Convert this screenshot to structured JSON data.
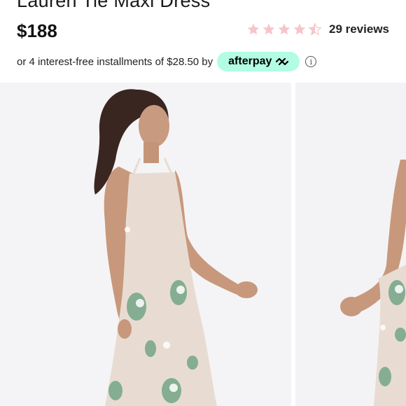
{
  "product": {
    "title": "Lauren Tie Maxi Dress",
    "price": "$188"
  },
  "rating": {
    "stars_value": 4.5,
    "stars_max": 5,
    "star_color": "#f7c5c8",
    "reviews_label": "29 reviews"
  },
  "payment": {
    "installment_text": "or 4 interest-free installments of $28.50 by",
    "provider_label": "afterpay",
    "badge_color": "#b2fce4"
  },
  "gallery": {
    "slides": [
      {
        "alt": "model wearing floral maxi dress, side view"
      },
      {
        "alt": "model wearing floral maxi dress, partial view"
      }
    ]
  }
}
